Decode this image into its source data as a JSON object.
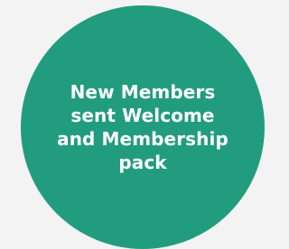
{
  "node": {
    "lines": [
      "New Members",
      "sent Welcome",
      "and Membership",
      "pack"
    ],
    "fill_color": "#229c7f",
    "text_color": "#ffffff",
    "background_color": "#f3f3f3"
  }
}
